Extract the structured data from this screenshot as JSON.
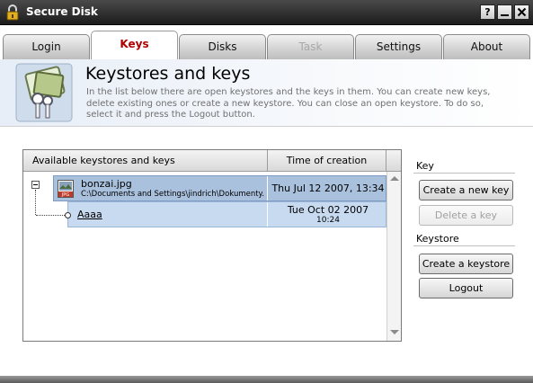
{
  "window": {
    "title": "Secure Disk",
    "help_label": "?",
    "minimize_icon": "minimize-icon",
    "close_icon": "close-icon",
    "app_icon": "padlock-icon"
  },
  "tabs": [
    {
      "label": "Login",
      "state": "normal"
    },
    {
      "label": "Keys",
      "state": "active"
    },
    {
      "label": "Disks",
      "state": "normal"
    },
    {
      "label": "Task",
      "state": "disabled"
    },
    {
      "label": "Settings",
      "state": "normal"
    },
    {
      "label": "About",
      "state": "normal"
    }
  ],
  "header": {
    "title": "Keystores and keys",
    "description": "In the list below there are open keystores and the keys in them. You can create new keys, delete existing ones or create a new keystore. You can close an open keystore. To do so, select it and press the Logout button.",
    "icon": "keys-icon"
  },
  "tree": {
    "columns": [
      "Available keystores and keys",
      "Time of creation"
    ],
    "keystore": {
      "name": "bonzai.jpg",
      "path": "C:\\Documents and Settings\\jindrich\\Dokumenty...",
      "created": "Thu Jul 12 2007, 13:34",
      "icon": "jpg-file-icon"
    },
    "key": {
      "name": "Aaaa",
      "created_date": "Tue Oct 02 2007",
      "created_time": "10:24"
    }
  },
  "panel": {
    "key_section": "Key",
    "create_key": "Create a new key",
    "delete_key": "Delete a key",
    "keystore_section": "Keystore",
    "create_keystore": "Create a keystore",
    "logout": "Logout"
  },
  "colors": {
    "active_tab_text": "#b00000",
    "selected_row": "#a9c1dd",
    "secondary_row": "#c8daf0",
    "titlebar": "#2a2a2a"
  }
}
